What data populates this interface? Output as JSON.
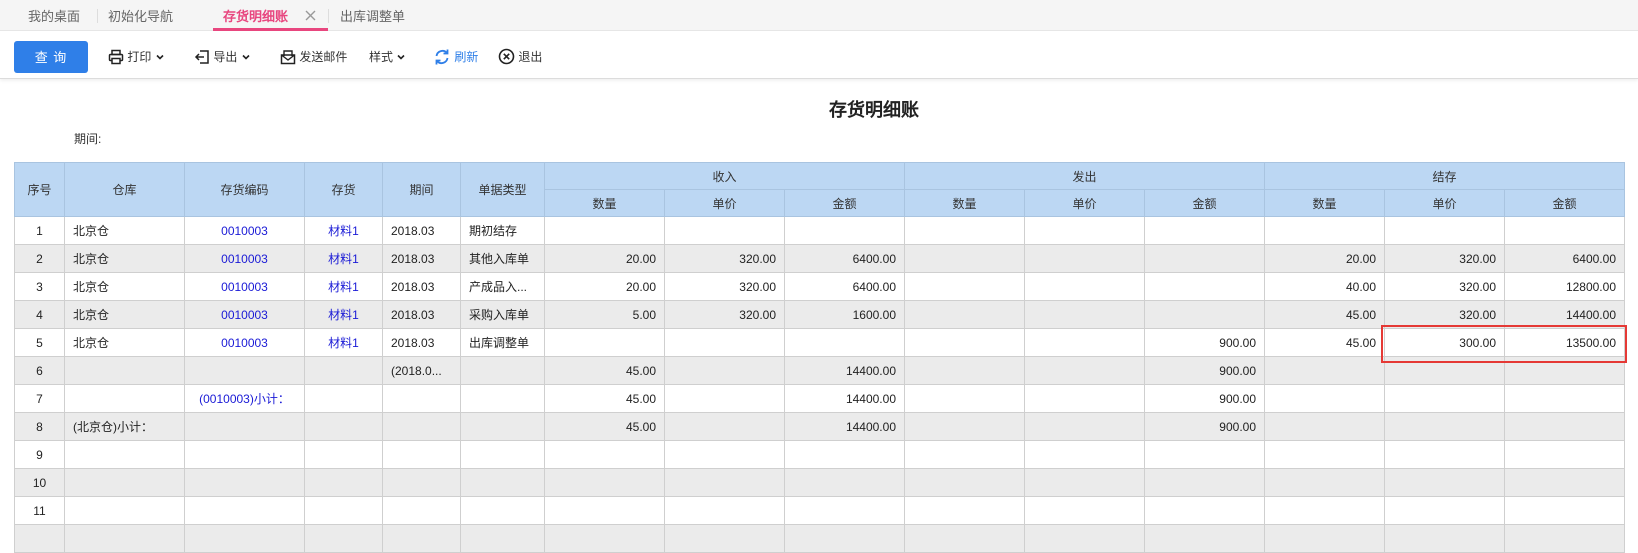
{
  "tabs": [
    {
      "label": "我的桌面"
    },
    {
      "label": "初始化导航"
    },
    {
      "label": "存货明细账"
    },
    {
      "label": "出库调整单"
    }
  ],
  "toolbar": {
    "query": "查 询",
    "print": "打印",
    "export": "导出",
    "send_mail": "发送邮件",
    "style": "样式",
    "refresh": "刷新",
    "exit": "退出"
  },
  "report": {
    "title": "存货明细账",
    "period_label": "期间:"
  },
  "colors": {
    "accent": "#2f7fe8",
    "active_tab": "#e8467f",
    "header_bg": "#bcd7f3",
    "highlight": "#e53935",
    "link": "#1a1ad6"
  },
  "table": {
    "headers": {
      "seq": "序号",
      "warehouse": "仓库",
      "code": "存货编码",
      "item": "存货",
      "period": "期间",
      "doc_type": "单据类型",
      "in": "收入",
      "out": "发出",
      "balance": "结存",
      "qty": "数量",
      "price": "单价",
      "amount": "金额"
    },
    "rows": [
      {
        "seq": "1",
        "warehouse": "北京仓",
        "code": "0010003",
        "item": "材料1",
        "period": "2018.03",
        "doc_type": "期初结存",
        "in_qty": "",
        "in_price": "",
        "in_amount": "",
        "out_qty": "",
        "out_price": "",
        "out_amount": "",
        "bal_qty": "",
        "bal_price": "",
        "bal_amount": ""
      },
      {
        "seq": "2",
        "warehouse": "北京仓",
        "code": "0010003",
        "item": "材料1",
        "period": "2018.03",
        "doc_type": "其他入库单",
        "in_qty": "20.00",
        "in_price": "320.00",
        "in_amount": "6400.00",
        "out_qty": "",
        "out_price": "",
        "out_amount": "",
        "bal_qty": "20.00",
        "bal_price": "320.00",
        "bal_amount": "6400.00"
      },
      {
        "seq": "3",
        "warehouse": "北京仓",
        "code": "0010003",
        "item": "材料1",
        "period": "2018.03",
        "doc_type": "产成品入...",
        "in_qty": "20.00",
        "in_price": "320.00",
        "in_amount": "6400.00",
        "out_qty": "",
        "out_price": "",
        "out_amount": "",
        "bal_qty": "40.00",
        "bal_price": "320.00",
        "bal_amount": "12800.00"
      },
      {
        "seq": "4",
        "warehouse": "北京仓",
        "code": "0010003",
        "item": "材料1",
        "period": "2018.03",
        "doc_type": "采购入库单",
        "in_qty": "5.00",
        "in_price": "320.00",
        "in_amount": "1600.00",
        "out_qty": "",
        "out_price": "",
        "out_amount": "",
        "bal_qty": "45.00",
        "bal_price": "320.00",
        "bal_amount": "14400.00"
      },
      {
        "seq": "5",
        "warehouse": "北京仓",
        "code": "0010003",
        "item": "材料1",
        "period": "2018.03",
        "doc_type": "出库调整单",
        "in_qty": "",
        "in_price": "",
        "in_amount": "",
        "out_qty": "",
        "out_price": "",
        "out_amount": "900.00",
        "bal_qty": "45.00",
        "bal_price": "300.00",
        "bal_amount": "13500.00"
      },
      {
        "seq": "6",
        "warehouse": "",
        "code": "",
        "item": "",
        "period": "(2018.0...",
        "doc_type": "",
        "in_qty": "45.00",
        "in_price": "",
        "in_amount": "14400.00",
        "out_qty": "",
        "out_price": "",
        "out_amount": "900.00",
        "bal_qty": "",
        "bal_price": "",
        "bal_amount": ""
      },
      {
        "seq": "7",
        "warehouse": "",
        "code": "(0010003)小计：",
        "item": "",
        "period": "",
        "doc_type": "",
        "in_qty": "45.00",
        "in_price": "",
        "in_amount": "14400.00",
        "out_qty": "",
        "out_price": "",
        "out_amount": "900.00",
        "bal_qty": "",
        "bal_price": "",
        "bal_amount": ""
      },
      {
        "seq": "8",
        "warehouse": "(北京仓)小计：",
        "code": "",
        "item": "",
        "period": "",
        "doc_type": "",
        "in_qty": "45.00",
        "in_price": "",
        "in_amount": "14400.00",
        "out_qty": "",
        "out_price": "",
        "out_amount": "900.00",
        "bal_qty": "",
        "bal_price": "",
        "bal_amount": ""
      },
      {
        "seq": "9",
        "warehouse": "",
        "code": "",
        "item": "",
        "period": "",
        "doc_type": "",
        "in_qty": "",
        "in_price": "",
        "in_amount": "",
        "out_qty": "",
        "out_price": "",
        "out_amount": "",
        "bal_qty": "",
        "bal_price": "",
        "bal_amount": ""
      },
      {
        "seq": "10",
        "warehouse": "",
        "code": "",
        "item": "",
        "period": "",
        "doc_type": "",
        "in_qty": "",
        "in_price": "",
        "in_amount": "",
        "out_qty": "",
        "out_price": "",
        "out_amount": "",
        "bal_qty": "",
        "bal_price": "",
        "bal_amount": ""
      },
      {
        "seq": "11",
        "warehouse": "",
        "code": "",
        "item": "",
        "period": "",
        "doc_type": "",
        "in_qty": "",
        "in_price": "",
        "in_amount": "",
        "out_qty": "",
        "out_price": "",
        "out_amount": "",
        "bal_qty": "",
        "bal_price": "",
        "bal_amount": ""
      },
      {
        "seq": "",
        "warehouse": "",
        "code": "",
        "item": "",
        "period": "",
        "doc_type": "",
        "in_qty": "",
        "in_price": "",
        "in_amount": "",
        "out_qty": "",
        "out_price": "",
        "out_amount": "",
        "bal_qty": "",
        "bal_price": "",
        "bal_amount": ""
      }
    ]
  }
}
